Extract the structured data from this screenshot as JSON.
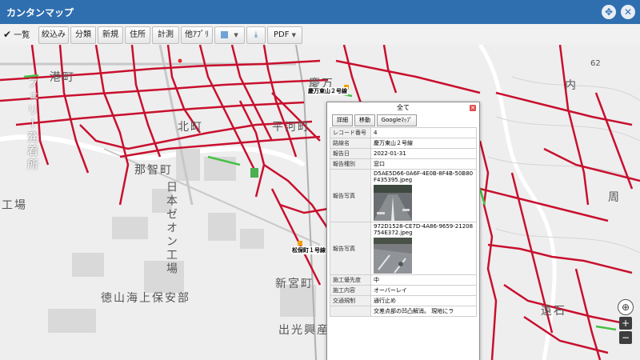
{
  "window": {
    "title": "カンタンマップ"
  },
  "toolbar": {
    "list": "一覧",
    "filter": "絞込み",
    "classify": "分類",
    "new": "新規",
    "address": "住所",
    "measure": "計測",
    "other_apps": "他ｱﾌﾟﾘ",
    "pdf": "PDF"
  },
  "map": {
    "labels": {
      "minato": "港町",
      "ferry": "フェリー発着所",
      "nachi": "那智町",
      "zeon": "日本ゼオン工場",
      "kojo": "工場",
      "shinmiya": "新宮町",
      "coast_guard": "徳山海上保安部",
      "idemitsu": "出光興産",
      "kitamachi": "北町",
      "hirakawa": "平河町",
      "keiman": "慶万",
      "route_keiman": "慶万東山２号線",
      "route_matsuho": "松保町１号線",
      "uchi": "内",
      "shuunan": "周",
      "toishi": "遠石",
      "elev": "62"
    }
  },
  "popup": {
    "header": "全て",
    "buttons": {
      "detail": "詳細",
      "move": "移動",
      "google": "Googleﾏｯﾌﾟ"
    },
    "rows": [
      {
        "key": "レコード番号",
        "value": "4"
      },
      {
        "key": "路線名",
        "value": "慶万東山２号線"
      },
      {
        "key": "報告日",
        "value": "2022-01-31"
      },
      {
        "key": "報告種別",
        "value": "窓口"
      },
      {
        "key": "報告写真",
        "value": "D5AE5D66-0A6F-4E0B-8F4B-50B80F435395.jpeg"
      },
      {
        "key": "報告写真",
        "value": "972D1528-CE7D-4A86-9659-21208754E372.jpeg"
      },
      {
        "key": "施工優先度",
        "value": "中"
      },
      {
        "key": "施工内容",
        "value": "オーバーレイ"
      },
      {
        "key": "交通規制",
        "value": "通行止め"
      },
      {
        "key": "",
        "value": "交差点部の凹凸解消。 現地にラ"
      }
    ]
  },
  "controls": {
    "zoom_in": "+",
    "zoom_out": "−"
  }
}
